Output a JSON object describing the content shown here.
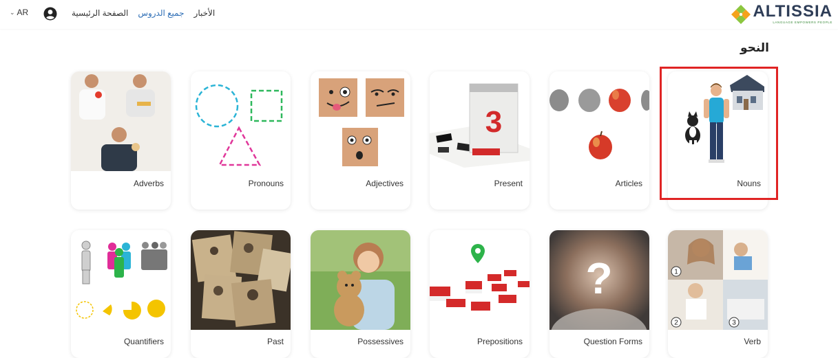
{
  "header": {
    "lang_label": "AR",
    "nav": [
      {
        "label": "الصفحة الرئيسية",
        "active": false
      },
      {
        "label": "جميع الدروس",
        "active": true
      },
      {
        "label": "الأخبار",
        "active": false
      }
    ],
    "logo_text": "ALTISSIA",
    "logo_tagline": "LANGUAGE EMPOWERS PEOPLE",
    "accent_color": "#2f6fb6"
  },
  "section": {
    "title": "النحو"
  },
  "row1": [
    {
      "label": "Nouns",
      "icon": "nouns-image"
    },
    {
      "label": "Articles",
      "icon": "articles-image"
    },
    {
      "label": "Present",
      "icon": "present-image"
    },
    {
      "label": "Adjectives",
      "icon": "adjectives-image"
    },
    {
      "label": "Pronouns",
      "icon": "pronouns-image"
    },
    {
      "label": "Adverbs",
      "icon": "adverbs-image"
    }
  ],
  "row2": [
    {
      "label": "Verb",
      "icon": "verb-image"
    },
    {
      "label": "Question Forms",
      "icon": "question-forms-image"
    },
    {
      "label": "Prepositions",
      "icon": "prepositions-image"
    },
    {
      "label": "Possessives",
      "icon": "possessives-image"
    },
    {
      "label": "Past",
      "icon": "past-image"
    },
    {
      "label": "Quantifiers",
      "icon": "quantifiers-image"
    }
  ],
  "verb_badges": [
    "1",
    "2",
    "3"
  ],
  "highlight_color": "#e02424"
}
